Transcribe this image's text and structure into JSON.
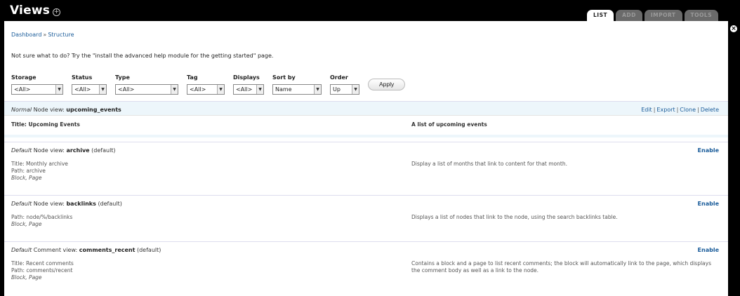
{
  "header": {
    "title": "Views",
    "title_icon": "plus-circle-icon",
    "tabs": [
      {
        "label": "LIST",
        "active": true
      },
      {
        "label": "ADD",
        "active": false
      },
      {
        "label": "IMPORT",
        "active": false
      },
      {
        "label": "TOOLS",
        "active": false
      }
    ]
  },
  "breadcrumb": {
    "items": [
      "Dashboard",
      "Structure"
    ],
    "separator": "»"
  },
  "help_text": "Not sure what to do? Try the \"install the advanced help module for the getting started\" page.",
  "filters": [
    {
      "label": "Storage",
      "value": "<All>"
    },
    {
      "label": "Status",
      "value": "<All>"
    },
    {
      "label": "Type",
      "value": "<All>"
    },
    {
      "label": "Tag",
      "value": "<All>"
    },
    {
      "label": "Displays",
      "value": "<All>"
    },
    {
      "label": "Sort by",
      "value": "Name"
    },
    {
      "label": "Order",
      "value": "Up"
    }
  ],
  "apply_label": "Apply",
  "views": [
    {
      "storage": "Normal",
      "type": "Node view:",
      "name": "upcoming_events",
      "suffix": "",
      "ops": [
        "Edit",
        "Export",
        "Clone",
        "Delete"
      ],
      "meta": [
        "Title: Upcoming Events"
      ],
      "displays": "",
      "description": "A list of upcoming events"
    },
    {
      "storage": "Default",
      "type": "Node view:",
      "name": "archive",
      "suffix": "(default)",
      "ops": [
        "Enable"
      ],
      "meta": [
        "Title: Monthly archive",
        "Path: archive"
      ],
      "displays": "Block, Page",
      "description": "Display a list of months that link to content for that month."
    },
    {
      "storage": "Default",
      "type": "Node view:",
      "name": "backlinks",
      "suffix": "(default)",
      "ops": [
        "Enable"
      ],
      "meta": [
        "Path: node/%/backlinks"
      ],
      "displays": "Block, Page",
      "description": "Displays a list of nodes that link to the node, using the search backlinks table."
    },
    {
      "storage": "Default",
      "type": "Comment view:",
      "name": "comments_recent",
      "suffix": "(default)",
      "ops": [
        "Enable"
      ],
      "meta": [
        "Title: Recent comments",
        "Path: comments/recent"
      ],
      "displays": "Block, Page",
      "description": "Contains a block and a page to list recent comments; the block will automatically link to the page, which displays the comment body as well as a link to the node."
    }
  ],
  "colors": {
    "link": "#1a5c9a",
    "enabled_row": "#edf6fb",
    "topbar": "#000000"
  }
}
